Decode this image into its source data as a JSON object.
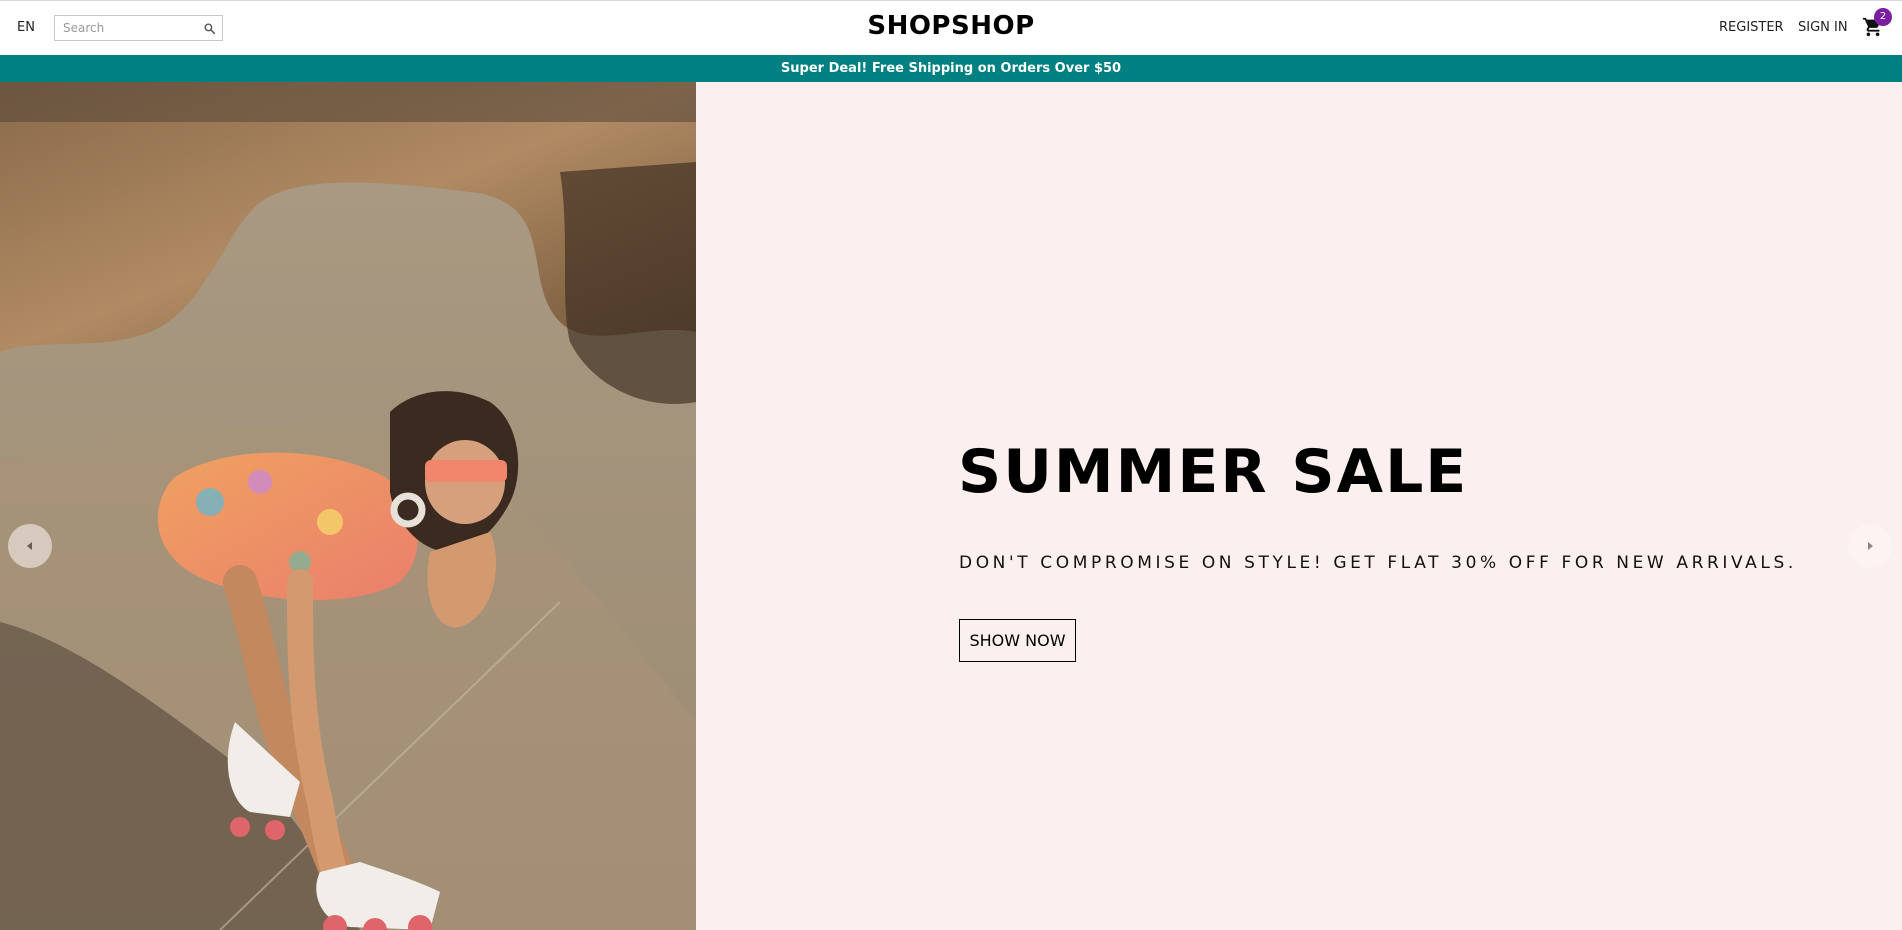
{
  "header": {
    "language": "EN",
    "search_placeholder": "Search",
    "logo": "SHOPSHOP",
    "register_label": "REGISTER",
    "signin_label": "SIGN IN",
    "cart_count": "2"
  },
  "announcement": {
    "text": "Super Deal! Free Shipping on Orders Over $50"
  },
  "slider": {
    "current_slide": {
      "title": "SUMMER SALE",
      "description": "DON'T COMPROMISE ON STYLE! GET FLAT 30% OFF FOR NEW ARRIVALS.",
      "button_label": "SHOW NOW",
      "background_color": "#fbf0ed"
    }
  },
  "colors": {
    "announcement_bg": "#008080",
    "cart_badge": "#7b1fa2"
  },
  "icons": {
    "search": "search-icon",
    "cart": "shopping-cart-icon",
    "prev": "arrow-left-icon",
    "next": "arrow-right-icon"
  }
}
